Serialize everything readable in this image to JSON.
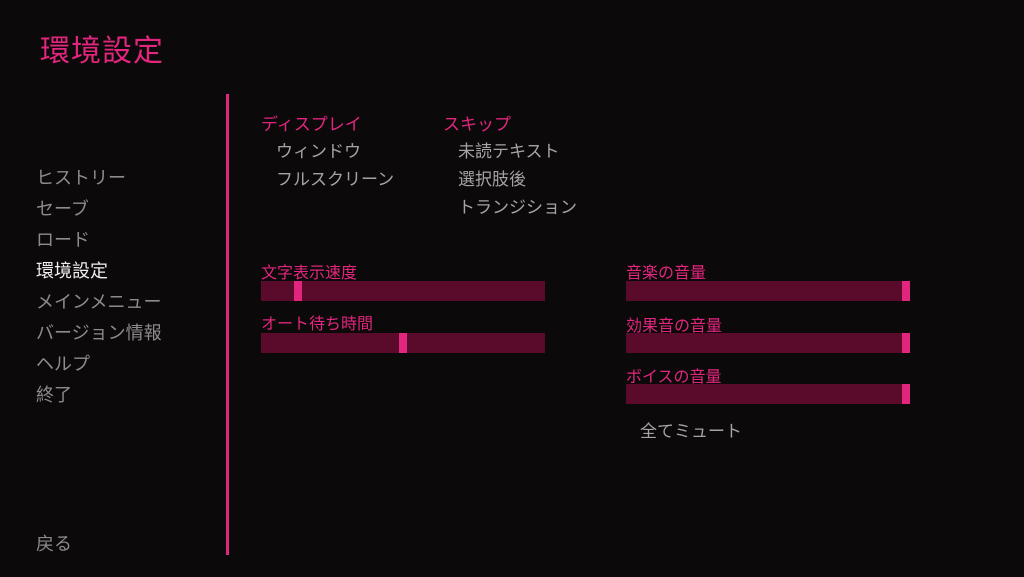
{
  "screen": {
    "title": "環境設定"
  },
  "nav": {
    "items": [
      {
        "label": "ヒストリー",
        "active": false
      },
      {
        "label": "セーブ",
        "active": false
      },
      {
        "label": "ロード",
        "active": false
      },
      {
        "label": "環境設定",
        "active": true
      },
      {
        "label": "メインメニュー",
        "active": false
      },
      {
        "label": "バージョン情報",
        "active": false
      },
      {
        "label": "ヘルプ",
        "active": false
      },
      {
        "label": "終了",
        "active": false
      }
    ],
    "return_label": "戻る"
  },
  "display": {
    "title": "ディスプレイ",
    "options": [
      "ウィンドウ",
      "フルスクリーン"
    ]
  },
  "skip": {
    "title": "スキップ",
    "options": [
      "未読テキスト",
      "選択肢後",
      "トランジション"
    ]
  },
  "sliders": {
    "text_speed": {
      "label": "文字表示速度",
      "value": 0.13
    },
    "auto_wait": {
      "label": "オート待ち時間",
      "value": 0.5
    },
    "music_volume": {
      "label": "音楽の音量",
      "value": 1.0
    },
    "sfx_volume": {
      "label": "効果音の音量",
      "value": 1.0
    },
    "voice_volume": {
      "label": "ボイスの音量",
      "value": 1.0
    }
  },
  "mute_all_label": "全てミュート",
  "colors": {
    "accent": "#e2267d",
    "slider_track": "#5a0a2a",
    "background": "#0c090b",
    "text_idle": "#8f8a8d",
    "text_active": "#f0eeee"
  }
}
